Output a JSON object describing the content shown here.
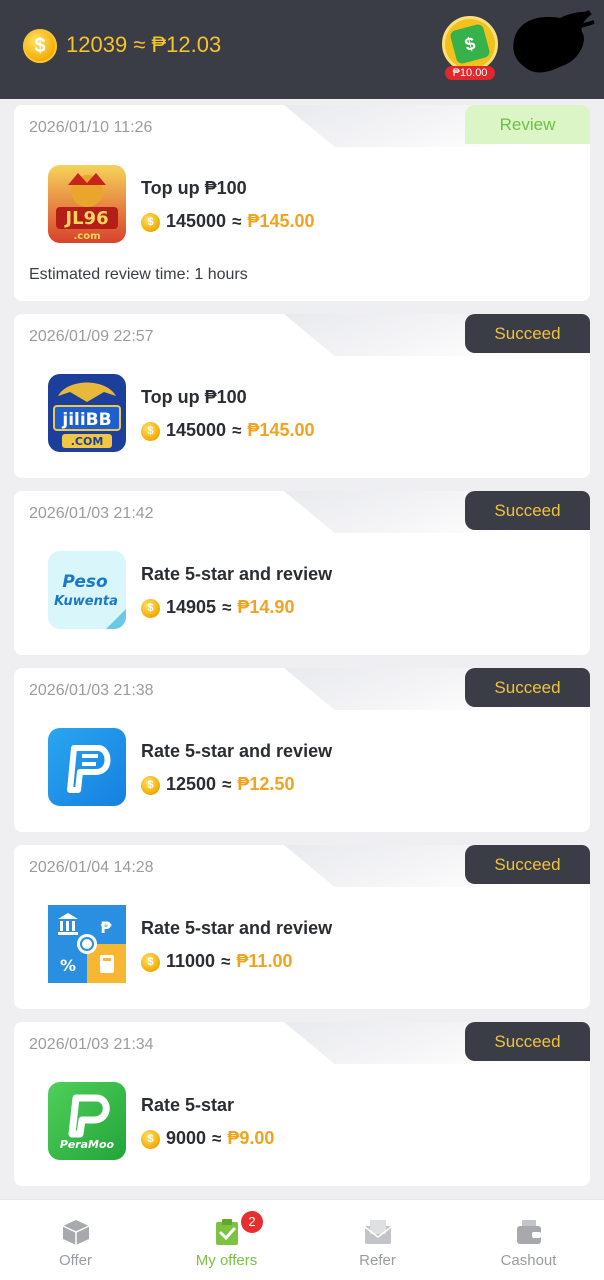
{
  "header": {
    "coin_balance": "12039",
    "balance_approx": "≈ ₱12.03",
    "bonus_amount": "₱10.00"
  },
  "offers": [
    {
      "date": "2026/01/10 11:26",
      "status": "Review",
      "app": "JL96",
      "title": "Top up ₱100",
      "coins": "145000",
      "approx": "≈",
      "peso": "₱145.00",
      "note": "Estimated review time: 1 hours"
    },
    {
      "date": "2026/01/09 22:57",
      "status": "Succeed",
      "app": "jiliBB",
      "title": "Top up ₱100",
      "coins": "145000",
      "approx": "≈",
      "peso": "₱145.00"
    },
    {
      "date": "2026/01/03 21:42",
      "status": "Succeed",
      "app": "Peso Kuwenta",
      "title": "Rate 5-star and review",
      "coins": "14905",
      "approx": "≈",
      "peso": "₱14.90"
    },
    {
      "date": "2026/01/03 21:38",
      "status": "Succeed",
      "app": "blue-p",
      "title": "Rate 5-star and review",
      "coins": "12500",
      "approx": "≈",
      "peso": "₱12.50"
    },
    {
      "date": "2026/01/04 14:28",
      "status": "Succeed",
      "app": "grid-finance",
      "title": "Rate 5-star and review",
      "coins": "11000",
      "approx": "≈",
      "peso": "₱11.00"
    },
    {
      "date": "2026/01/03 21:34",
      "status": "Succeed",
      "app": "PeraMoo",
      "title": "Rate 5-star",
      "coins": "9000",
      "approx": "≈",
      "peso": "₱9.00"
    }
  ],
  "app_icon_text": {
    "jl96": "JL96",
    "jl96_sub": ".com",
    "jilibb": "jiliBB",
    "jilibb_sub": ".COM",
    "peso": "Peso",
    "kuwenta": "Kuwenta",
    "peramoo": "PeraMoo"
  },
  "nav": {
    "items": [
      {
        "label": "Offer",
        "icon": "box-icon"
      },
      {
        "label": "My offers",
        "icon": "clipboard-check-icon",
        "badge": "2",
        "active": true
      },
      {
        "label": "Refer",
        "icon": "envelope-icon"
      },
      {
        "label": "Cashout",
        "icon": "wallet-icon"
      }
    ]
  },
  "colors": {
    "header_bg": "#3a3d46",
    "gold": "#f5c32b",
    "peso_orange": "#f2a31e",
    "review_green": "#6dc043",
    "active_nav": "#7cc243"
  }
}
